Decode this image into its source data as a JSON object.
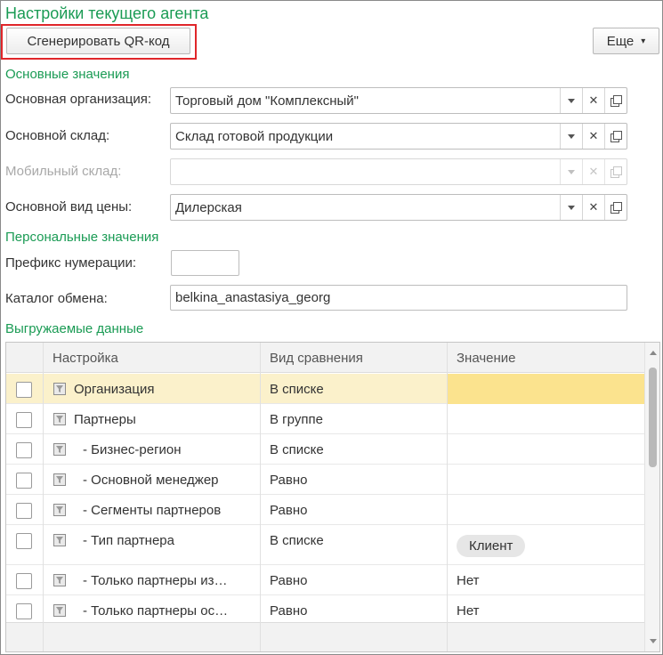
{
  "title": "Настройки текущего агента",
  "toolbar": {
    "qr_label": "Сгенерировать QR-код",
    "more_label": "Еще"
  },
  "sections": {
    "main": "Основные значения",
    "personal": "Персональные значения",
    "export": "Выгружаемые данные"
  },
  "fields": {
    "organization": {
      "label": "Основная организация:",
      "value": "Торговый дом \"Комплексный\""
    },
    "warehouse": {
      "label": "Основной склад:",
      "value": "Склад готовой продукции"
    },
    "mobile_warehouse": {
      "label": "Мобильный склад:",
      "value": ""
    },
    "price_type": {
      "label": "Основной вид цены:",
      "value": "Дилерская"
    },
    "prefix": {
      "label": "Префикс нумерации:",
      "value": ""
    },
    "exchange_dir": {
      "label": "Каталог обмена:",
      "value": "belkina_anastasiya_georg"
    }
  },
  "icons": {
    "dropdown": "▾",
    "clear": "✕",
    "open": "open-icon"
  },
  "table": {
    "columns": [
      "Настройка",
      "Вид сравнения",
      "Значение"
    ],
    "rows": [
      {
        "name": "Организация",
        "cmp": "В списке",
        "value": ""
      },
      {
        "name": "Партнеры",
        "cmp": "В группе",
        "value": ""
      },
      {
        "name": "- Бизнес-регион",
        "cmp": "В списке",
        "value": ""
      },
      {
        "name": "- Основной менеджер",
        "cmp": "Равно",
        "value": ""
      },
      {
        "name": "- Сегменты партнеров",
        "cmp": "Равно",
        "value": ""
      },
      {
        "name": "- Тип партнера",
        "cmp": "В списке",
        "value": "Клиент"
      },
      {
        "name": "- Только партнеры из…",
        "cmp": "Равно",
        "value": "Нет"
      },
      {
        "name": "- Только партнеры ос…",
        "cmp": "Равно",
        "value": "Нет"
      }
    ]
  },
  "colors": {
    "accent": "#1a9b54",
    "highlight": "#e0262a",
    "selected_row": "#fbf1cb",
    "selected_cell": "#fbe38e"
  }
}
